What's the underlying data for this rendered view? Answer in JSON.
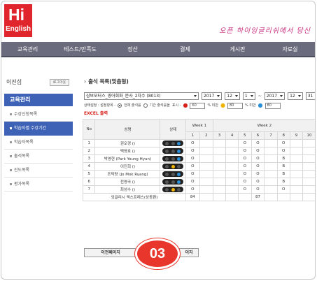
{
  "brand": {
    "line1": "Hi",
    "line2": "English",
    "slogan": "오픈 하이잉글리쉬에서 당신"
  },
  "nav": [
    "교육관리",
    "테스트/만족도",
    "정산",
    "결제",
    "게시판",
    "자료실"
  ],
  "sidebar": {
    "user_name": "이진섭",
    "logout_label": "로그아웃",
    "section_title": "교육관리",
    "items": [
      {
        "label": "수강신청목록",
        "active": false
      },
      {
        "label": "학습자별 수강기간",
        "active": true
      },
      {
        "label": "학습자목록",
        "active": false
      },
      {
        "label": "출석목록",
        "active": false
      },
      {
        "label": "진도목록",
        "active": false
      },
      {
        "label": "평가목록",
        "active": false
      }
    ]
  },
  "main": {
    "title": "출석 목록(맞춤형)",
    "course_select": "삼보모터스_영어회화_문사_2차수 (8013)",
    "start_year": "2017",
    "start_month": "12",
    "start_day": "1",
    "range_sep": "~",
    "end_year": "2017",
    "end_month": "12",
    "end_day": "31",
    "options_label": "상태설정 : 설정항목 -",
    "radio_all": "전체 출석률",
    "radio_period": "기간 출석률을",
    "show_label": "표시 -",
    "pct1": "60",
    "pct2": "80",
    "pct3": "80",
    "pct_suffix": "% 미만",
    "excel_label": "EXCEL 출력",
    "colors": {
      "red": "#d8201a",
      "yellow": "#f0b400",
      "blue": "#2a8fd6",
      "accent": "#3d62b6"
    }
  },
  "table": {
    "headers": {
      "no": "No",
      "name": "성명",
      "status": "상태"
    },
    "weeks": [
      "Week 1",
      "Week 2"
    ],
    "days": [
      "1",
      "2",
      "3",
      "4",
      "5",
      "6",
      "7",
      "8",
      "9",
      "10"
    ],
    "rows": [
      {
        "no": "1",
        "name": "권오경 ()",
        "light": "green",
        "marks": [
          "O",
          "",
          "",
          "",
          "O",
          "O",
          "",
          "O",
          "",
          ""
        ]
      },
      {
        "no": "2",
        "name": "백영호 ()",
        "light": "blue",
        "marks": [
          "O",
          "",
          "",
          "",
          "O",
          "O",
          "",
          "O",
          "",
          ""
        ]
      },
      {
        "no": "3",
        "name": "박영현 (Park Young Hyun)",
        "light": "blue",
        "marks": [
          "O",
          "",
          "",
          "",
          "O",
          "O",
          "",
          "B",
          "",
          ""
        ]
      },
      {
        "no": "4",
        "name": "이진희 ()",
        "light": "yellow",
        "marks": [
          "O",
          "",
          "",
          "",
          "O",
          "O",
          "",
          "B",
          "",
          ""
        ]
      },
      {
        "no": "5",
        "name": "조막량 (Jo Mok Ryang)",
        "light": "blue",
        "marks": [
          "O",
          "",
          "",
          "",
          "O",
          "O",
          "",
          "B",
          "",
          ""
        ]
      },
      {
        "no": "6",
        "name": "전영국 ()",
        "light": "blue",
        "marks": [
          "O",
          "",
          "",
          "",
          "O",
          "O",
          "",
          "B",
          "",
          ""
        ]
      },
      {
        "no": "7",
        "name": "최성수 ()",
        "light": "yellow",
        "marks": [
          "O",
          "",
          "",
          "",
          "O",
          "O",
          "",
          "O",
          "",
          ""
        ]
      }
    ],
    "summary": {
      "label": "잉글리시 엑스프레스(상동편)",
      "day1": "84",
      "day6": "87"
    }
  },
  "footer": {
    "prev_label": "이전페이지",
    "next_label": "이지",
    "step_badge": "03"
  }
}
